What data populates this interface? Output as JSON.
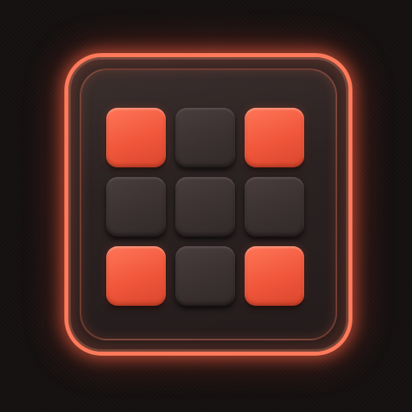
{
  "icon": {
    "name": "grid-pads-app-icon",
    "accent_color": "#ff6a4a",
    "off_color": "#3b3131",
    "frame_color": "#ff7a5a"
  },
  "grid": {
    "rows": 3,
    "cols": 3,
    "pads": [
      {
        "row": 1,
        "col": 1,
        "state": "on"
      },
      {
        "row": 1,
        "col": 2,
        "state": "off"
      },
      {
        "row": 1,
        "col": 3,
        "state": "on"
      },
      {
        "row": 2,
        "col": 1,
        "state": "off"
      },
      {
        "row": 2,
        "col": 2,
        "state": "off"
      },
      {
        "row": 2,
        "col": 3,
        "state": "off"
      },
      {
        "row": 3,
        "col": 1,
        "state": "on"
      },
      {
        "row": 3,
        "col": 2,
        "state": "off"
      },
      {
        "row": 3,
        "col": 3,
        "state": "on"
      }
    ]
  }
}
